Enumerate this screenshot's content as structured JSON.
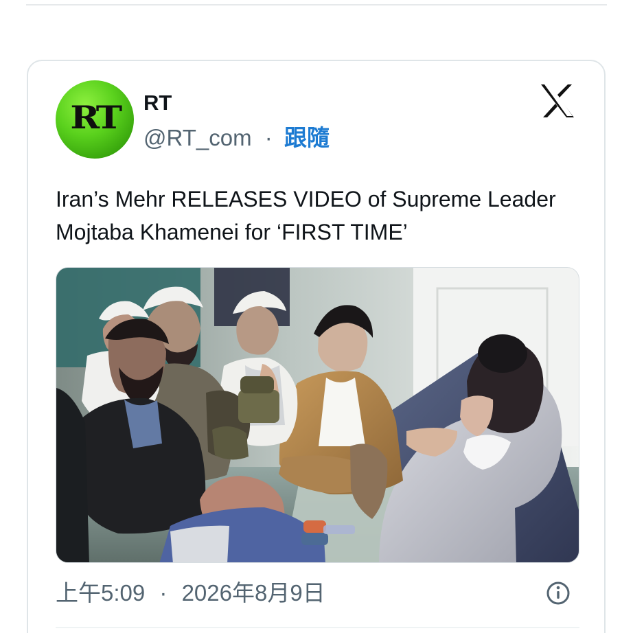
{
  "account": {
    "avatar_logo_text": "RT",
    "display_name": "RT",
    "handle": "@RT_com",
    "separator": "·",
    "follow_label": "跟隨"
  },
  "brand": {
    "icon_name": "x-logo-icon"
  },
  "tweet": {
    "text": "Iran’s Mehr RELEASES VIDEO of Supreme Leader Mojtaba Khamenei for ‘FIRST TIME’",
    "time": "上午5:09",
    "separator": "·",
    "date": "2026年8月9日"
  },
  "icons": {
    "info": "info-icon"
  },
  "colors": {
    "text_primary": "#0f1419",
    "text_secondary": "#536471",
    "follow_link": "#1d7bd2",
    "avatar_green": "#4bbf17",
    "card_border": "#dfe5e8"
  }
}
